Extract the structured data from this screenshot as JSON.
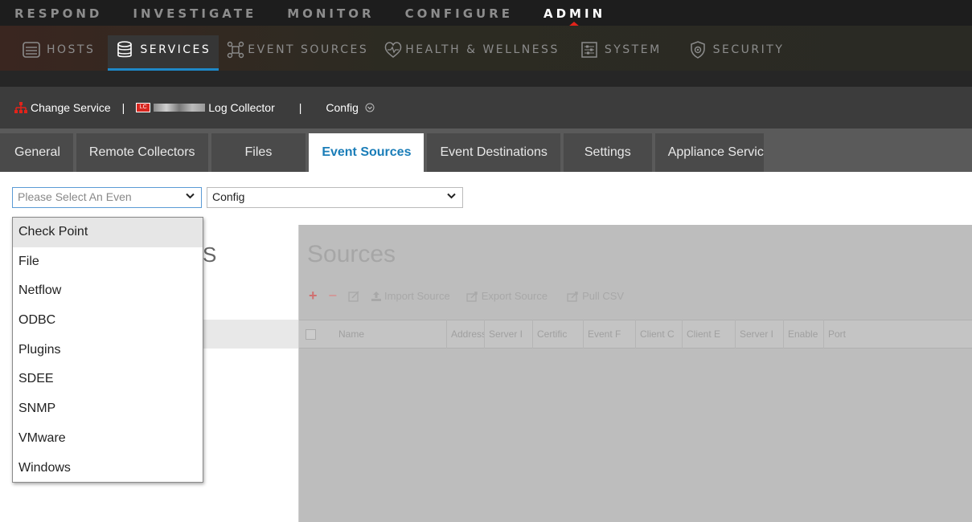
{
  "top_nav": {
    "items": [
      {
        "label": "RESPOND",
        "active": false
      },
      {
        "label": "INVESTIGATE",
        "active": false
      },
      {
        "label": "MONITOR",
        "active": false
      },
      {
        "label": "CONFIGURE",
        "active": false
      },
      {
        "label": "ADMIN",
        "active": true
      }
    ]
  },
  "sub_nav": {
    "items": [
      {
        "label": "HOSTS",
        "icon": "hosts-icon",
        "active": false
      },
      {
        "label": "SERVICES",
        "icon": "database-icon",
        "active": true
      },
      {
        "label": "EVENT SOURCES",
        "icon": "network-icon",
        "active": false
      },
      {
        "label": "HEALTH & WELLNESS",
        "icon": "heart-icon",
        "active": false
      },
      {
        "label": "SYSTEM",
        "icon": "sliders-icon",
        "active": false
      },
      {
        "label": "SECURITY",
        "icon": "shield-gear-icon",
        "active": false
      }
    ]
  },
  "service_bar": {
    "change_service": "Change Service",
    "separator": "|",
    "badge": "LC",
    "service_name": "Log Collector",
    "config": "Config",
    "config_icon": "circle-chevron-down-icon"
  },
  "tabs": {
    "items": [
      {
        "label": "General",
        "active": false
      },
      {
        "label": "Remote Collectors",
        "active": false
      },
      {
        "label": "Files",
        "active": false
      },
      {
        "label": "Event Sources",
        "active": true
      },
      {
        "label": "Event Destinations",
        "active": false
      },
      {
        "label": "Settings",
        "active": false
      },
      {
        "label": "Appliance Servic",
        "active": false
      }
    ]
  },
  "selectors": {
    "event_type_placeholder": "Please Select An Even",
    "config_value": "Config"
  },
  "left_panel": {
    "heading_fragment": "S"
  },
  "sources": {
    "title": "Sources",
    "toolbar": {
      "import": "Import Source",
      "export": "Export Source",
      "pull_csv": "Pull CSV"
    },
    "columns": [
      "Name",
      "Address",
      "Server I",
      "Certific",
      "Event F",
      "Client C",
      "Client E",
      "Server I",
      "Enable",
      "Port"
    ]
  },
  "dropdown": {
    "options": [
      "Check Point",
      "File",
      "Netflow",
      "ODBC",
      "Plugins",
      "SDEE",
      "SNMP",
      "VMware",
      "Windows"
    ],
    "highlighted_index": 0
  },
  "colors": {
    "accent": "#1e88c7",
    "active_tab_text": "#1a7db8",
    "admin_marker": "#e2231a"
  }
}
